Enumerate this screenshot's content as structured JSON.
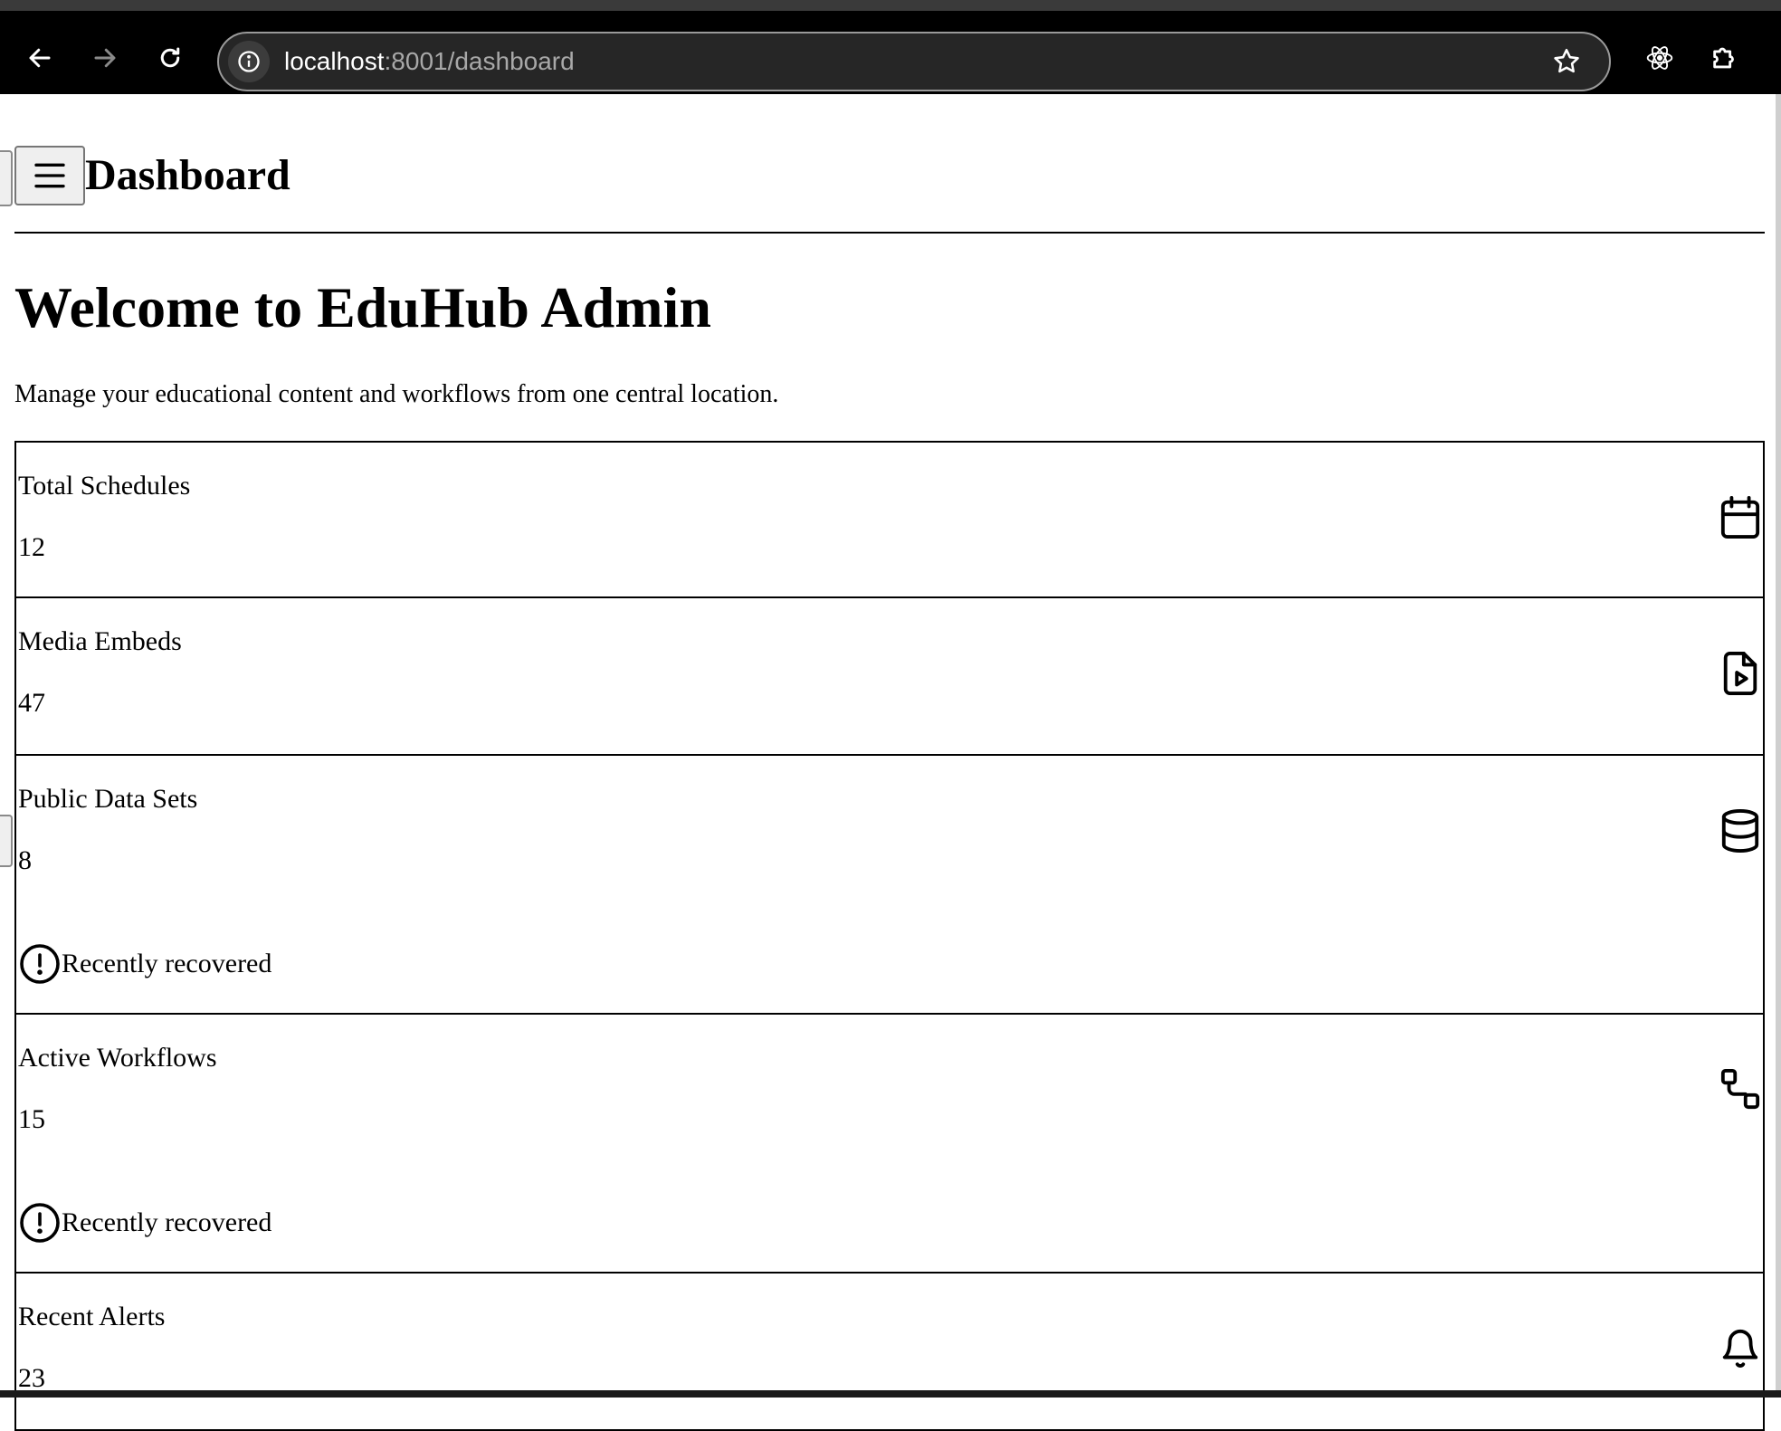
{
  "browser": {
    "url_host": "localhost",
    "url_path": ":8001/dashboard",
    "back_icon": "arrow-left-icon",
    "forward_icon": "arrow-right-icon",
    "reload_icon": "reload-icon",
    "site_info_icon": "info-icon",
    "bookmark_icon": "star-icon",
    "react_devtools_icon": "react-icon",
    "extensions_icon": "puzzle-icon"
  },
  "header": {
    "menu_icon": "hamburger-menu-icon",
    "title": "Dashboard"
  },
  "main": {
    "heading": "Welcome to EduHub Admin",
    "intro": "Manage your educational content and workflows from one central location."
  },
  "cards": [
    {
      "label": "Total Schedules",
      "value": "12",
      "icon": "calendar-icon",
      "status": null
    },
    {
      "label": "Media Embeds",
      "value": "47",
      "icon": "file-play-icon",
      "status": null
    },
    {
      "label": "Public Data Sets",
      "value": "8",
      "icon": "database-icon",
      "status": "Recently recovered"
    },
    {
      "label": "Active Workflows",
      "value": "15",
      "icon": "workflow-icon",
      "status": "Recently recovered"
    },
    {
      "label": "Recent Alerts",
      "value": "23",
      "icon": "bell-icon",
      "status": null
    }
  ]
}
